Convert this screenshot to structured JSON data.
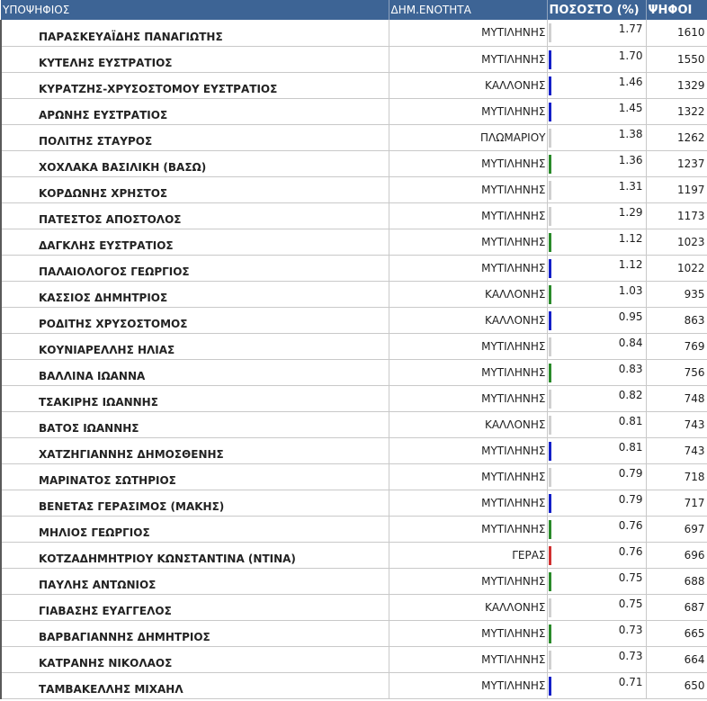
{
  "header": {
    "candidate": "ΥΠΟΨΗΦΙΟΣ",
    "district": "ΔΗΜ.ΕΝΟΤΗΤΑ",
    "percent": "ΠΟΣΟΣΤΟ (%)",
    "votes": "ΨΗΦΟΙ"
  },
  "colors": {
    "header_bg": "#3d6495",
    "bar_blue": "#1420c8",
    "bar_green": "#2a8a2a",
    "bar_gray": "#d0d0d0",
    "bar_red": "#d03030"
  },
  "rows": [
    {
      "name": "ΠΑΡΑΣΚΕΥΑΪΔΗΣ ΠΑΝΑΓΙΩΤΗΣ",
      "district": "ΜΥΤΙΛΗΝΗΣ",
      "percent": "1.77",
      "votes": "1610",
      "bar_color": "gray"
    },
    {
      "name": "ΚΥΤΕΛΗΣ ΕΥΣΤΡΑΤΙΟΣ",
      "district": "ΜΥΤΙΛΗΝΗΣ",
      "percent": "1.70",
      "votes": "1550",
      "bar_color": "blue"
    },
    {
      "name": "ΚΥΡΑΤΖΗΣ-ΧΡΥΣΟΣΤΟΜΟΥ ΕΥΣΤΡΑΤΙΟΣ",
      "district": "ΚΑΛΛΟΝΗΣ",
      "percent": "1.46",
      "votes": "1329",
      "bar_color": "blue"
    },
    {
      "name": "ΑΡΩΝΗΣ ΕΥΣΤΡΑΤΙΟΣ",
      "district": "ΜΥΤΙΛΗΝΗΣ",
      "percent": "1.45",
      "votes": "1322",
      "bar_color": "blue"
    },
    {
      "name": "ΠΟΛΙΤΗΣ ΣΤΑΥΡΟΣ",
      "district": "ΠΛΩΜΑΡΙΟΥ",
      "percent": "1.38",
      "votes": "1262",
      "bar_color": "gray"
    },
    {
      "name": "ΧΟΧΛΑΚΑ ΒΑΣΙΛΙΚΗ (ΒΑΣΩ)",
      "district": "ΜΥΤΙΛΗΝΗΣ",
      "percent": "1.36",
      "votes": "1237",
      "bar_color": "green"
    },
    {
      "name": "ΚΟΡΔΩΝΗΣ ΧΡΗΣΤΟΣ",
      "district": "ΜΥΤΙΛΗΝΗΣ",
      "percent": "1.31",
      "votes": "1197",
      "bar_color": "gray"
    },
    {
      "name": "ΠΑΤΕΣΤΟΣ ΑΠΟΣΤΟΛΟΣ",
      "district": "ΜΥΤΙΛΗΝΗΣ",
      "percent": "1.29",
      "votes": "1173",
      "bar_color": "gray"
    },
    {
      "name": "ΔΑΓΚΛΗΣ ΕΥΣΤΡΑΤΙΟΣ",
      "district": "ΜΥΤΙΛΗΝΗΣ",
      "percent": "1.12",
      "votes": "1023",
      "bar_color": "green"
    },
    {
      "name": "ΠΑΛΑΙΟΛΟΓΟΣ ΓΕΩΡΓΙΟΣ",
      "district": "ΜΥΤΙΛΗΝΗΣ",
      "percent": "1.12",
      "votes": "1022",
      "bar_color": "blue"
    },
    {
      "name": "ΚΑΣΣΙΟΣ ΔΗΜΗΤΡΙΟΣ",
      "district": "ΚΑΛΛΟΝΗΣ",
      "percent": "1.03",
      "votes": "935",
      "bar_color": "green"
    },
    {
      "name": "ΡΟΔΙΤΗΣ ΧΡΥΣΟΣΤΟΜΟΣ",
      "district": "ΚΑΛΛΟΝΗΣ",
      "percent": "0.95",
      "votes": "863",
      "bar_color": "blue"
    },
    {
      "name": "ΚΟΥΝΙΑΡΕΛΛΗΣ ΗΛΙΑΣ",
      "district": "ΜΥΤΙΛΗΝΗΣ",
      "percent": "0.84",
      "votes": "769",
      "bar_color": "gray"
    },
    {
      "name": "ΒΑΛΛΙΝΑ ΙΩΑΝΝΑ",
      "district": "ΜΥΤΙΛΗΝΗΣ",
      "percent": "0.83",
      "votes": "756",
      "bar_color": "green"
    },
    {
      "name": "ΤΣΑΚΙΡΗΣ ΙΩΑΝΝΗΣ",
      "district": "ΜΥΤΙΛΗΝΗΣ",
      "percent": "0.82",
      "votes": "748",
      "bar_color": "gray"
    },
    {
      "name": "ΒΑΤΟΣ ΙΩΑΝΝΗΣ",
      "district": "ΚΑΛΛΟΝΗΣ",
      "percent": "0.81",
      "votes": "743",
      "bar_color": "gray"
    },
    {
      "name": "ΧΑΤΖΗΓΙΑΝΝΗΣ ΔΗΜΟΣΘΕΝΗΣ",
      "district": "ΜΥΤΙΛΗΝΗΣ",
      "percent": "0.81",
      "votes": "743",
      "bar_color": "blue"
    },
    {
      "name": "ΜΑΡΙΝΑΤΟΣ ΣΩΤΗΡΙΟΣ",
      "district": "ΜΥΤΙΛΗΝΗΣ",
      "percent": "0.79",
      "votes": "718",
      "bar_color": "gray"
    },
    {
      "name": "ΒΕΝΕΤΑΣ ΓΕΡΑΣΙΜΟΣ (ΜΑΚΗΣ)",
      "district": "ΜΥΤΙΛΗΝΗΣ",
      "percent": "0.79",
      "votes": "717",
      "bar_color": "blue"
    },
    {
      "name": "ΜΗΛΙΟΣ ΓΕΩΡΓΙΟΣ",
      "district": "ΜΥΤΙΛΗΝΗΣ",
      "percent": "0.76",
      "votes": "697",
      "bar_color": "green"
    },
    {
      "name": "ΚΟΤΖΑΔΗΜΗΤΡΙΟΥ ΚΩΝΣΤΑΝΤΙΝΑ (ΝΤΙΝΑ)",
      "district": "ΓΕΡΑΣ",
      "percent": "0.76",
      "votes": "696",
      "bar_color": "red"
    },
    {
      "name": "ΠΑΥΛΗΣ ΑΝΤΩΝΙΟΣ",
      "district": "ΜΥΤΙΛΗΝΗΣ",
      "percent": "0.75",
      "votes": "688",
      "bar_color": "green"
    },
    {
      "name": "ΓΙΑΒΑΣΗΣ ΕΥΑΓΓΕΛΟΣ",
      "district": "ΚΑΛΛΟΝΗΣ",
      "percent": "0.75",
      "votes": "687",
      "bar_color": "gray"
    },
    {
      "name": "ΒΑΡΒΑΓΙΑΝΝΗΣ ΔΗΜΗΤΡΙΟΣ",
      "district": "ΜΥΤΙΛΗΝΗΣ",
      "percent": "0.73",
      "votes": "665",
      "bar_color": "green"
    },
    {
      "name": "ΚΑΤΡΑΝΗΣ ΝΙΚΟΛΑΟΣ",
      "district": "ΜΥΤΙΛΗΝΗΣ",
      "percent": "0.73",
      "votes": "664",
      "bar_color": "gray"
    },
    {
      "name": "ΤΑΜΒΑΚΕΛΛΗΣ ΜΙΧΑΗΛ",
      "district": "ΜΥΤΙΛΗΝΗΣ",
      "percent": "0.71",
      "votes": "650",
      "bar_color": "blue"
    }
  ]
}
